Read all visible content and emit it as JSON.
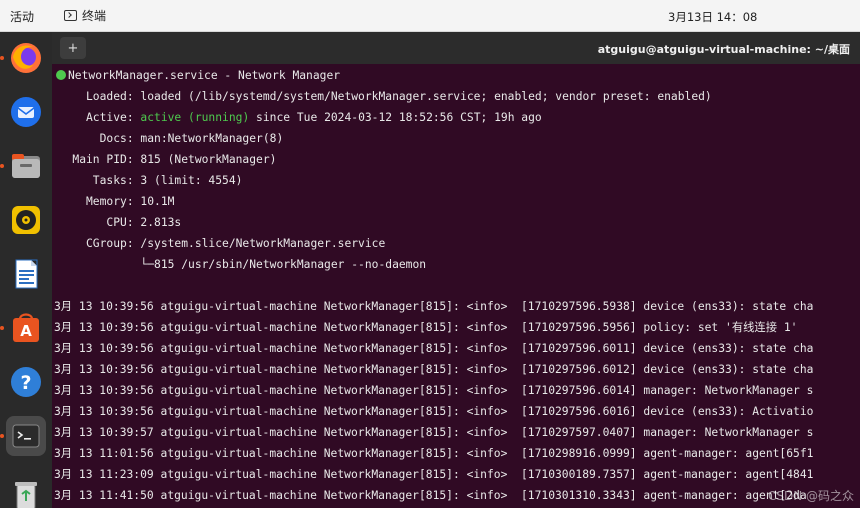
{
  "topbar": {
    "activities": "活动",
    "app_name": "终端",
    "clock": "3月13日  14：08"
  },
  "dock": {
    "apps": [
      {
        "name": "firefox-icon",
        "running": true
      },
      {
        "name": "thunderbird-icon",
        "running": false
      },
      {
        "name": "files-icon",
        "running": true
      },
      {
        "name": "rhythmbox-icon",
        "running": false
      },
      {
        "name": "writer-icon",
        "running": false
      },
      {
        "name": "app-center-icon",
        "running": true
      },
      {
        "name": "help-icon",
        "running": false
      },
      {
        "name": "terminal-icon",
        "running": true
      },
      {
        "name": "trash-icon",
        "running": false
      }
    ]
  },
  "window": {
    "title": "atguigu@atguigu-virtual-machine: ~/桌面",
    "new_tab_symbol": "+"
  },
  "status": {
    "header": "NetworkManager.service - Network Manager",
    "loaded": "     Loaded: loaded (/lib/systemd/system/NetworkManager.service; enabled; vendor preset: enabled)",
    "active_label": "     Active: ",
    "active_state": "active (running)",
    "active_rest": " since Tue 2024-03-12 18:52:56 CST; 19h ago",
    "docs": "       Docs: man:NetworkManager(8)",
    "main_pid": "   Main PID: 815 (NetworkManager)",
    "tasks": "      Tasks: 3 (limit: 4554)",
    "memory": "     Memory: 10.1M",
    "cpu": "        CPU: 2.813s",
    "cgroup": "     CGroup: /system.slice/NetworkManager.service",
    "cgroup_child": "             └─815 /usr/sbin/NetworkManager --no-daemon"
  },
  "logs": [
    "3月 13 10:39:56 atguigu-virtual-machine NetworkManager[815]: <info>  [1710297596.5938] device (ens33): state cha",
    "3月 13 10:39:56 atguigu-virtual-machine NetworkManager[815]: <info>  [1710297596.5956] policy: set '有线连接 1'",
    "3月 13 10:39:56 atguigu-virtual-machine NetworkManager[815]: <info>  [1710297596.6011] device (ens33): state cha",
    "3月 13 10:39:56 atguigu-virtual-machine NetworkManager[815]: <info>  [1710297596.6012] device (ens33): state cha",
    "3月 13 10:39:56 atguigu-virtual-machine NetworkManager[815]: <info>  [1710297596.6014] manager: NetworkManager s",
    "3月 13 10:39:56 atguigu-virtual-machine NetworkManager[815]: <info>  [1710297596.6016] device (ens33): Activatio",
    "3月 13 10:39:57 atguigu-virtual-machine NetworkManager[815]: <info>  [1710297597.0407] manager: NetworkManager s",
    "3月 13 11:01:56 atguigu-virtual-machine NetworkManager[815]: <info>  [1710298916.0999] agent-manager: agent[65f1",
    "3月 13 11:23:09 atguigu-virtual-machine NetworkManager[815]: <info>  [1710300189.7357] agent-manager: agent[4841",
    "3月 13 11:41:50 atguigu-virtual-machine NetworkManager[815]: <info>  [1710301310.3343] agent-manager: agent[2da"
  ],
  "watermark": "CSDN @码之众"
}
